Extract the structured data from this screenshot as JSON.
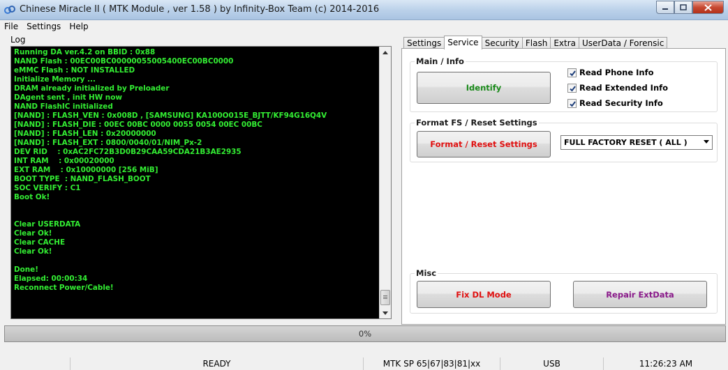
{
  "window": {
    "title": "Chinese Miracle II ( MTK Module , ver 1.58 ) by Infinity-Box Team (c) 2014-2016",
    "icon": "cm-logo-icon"
  },
  "menu": [
    "File",
    "Settings",
    "Help"
  ],
  "log": {
    "label": "Log",
    "text_color": "#33ee33",
    "lines": [
      "Running DA ver.4.2 on BBID : 0x88",
      "NAND Flash : 00EC00BC00000055005400EC00BC0000",
      "eMMC Flash : NOT INSTALLED",
      "Initialize Memory ...",
      "DRAM already initialized by Preloader",
      "DAgent sent , init HW now",
      "NAND FlashIC initialized",
      "[NAND] : FLASH_VEN : 0x008D , [SAMSUNG] KA100O015E_BJTT/KF94G16Q4V",
      "[NAND] : FLASH_DIE : 00EC 00BC 0000 0055 0054 00EC 00BC",
      "[NAND] : FLASH_LEN : 0x20000000",
      "[NAND] : FLASH_EXT : 0800/0040/01/NIM_Px-2",
      "DEV RID    : 0xAC2FC72B3D0B29CAA59CDA21B3AE2935",
      "INT RAM    : 0x00020000",
      "EXT RAM    : 0x10000000 [256 MiB]",
      "BOOT TYPE  : NAND_FLASH_BOOT",
      "SOC VERIFY : C1",
      "Boot Ok!",
      "",
      "",
      "Clear USERDATA",
      "Clear Ok!",
      "Clear CACHE",
      "Clear Ok!",
      "",
      "Done!",
      "Elapsed: 00:00:34",
      "Reconnect Power/Cable!"
    ]
  },
  "tabs": [
    "Settings",
    "Service",
    "Security",
    "Flash",
    "Extra",
    "UserData / Forensic"
  ],
  "active_tab": "Service",
  "main_info": {
    "title": "Main / Info",
    "identify_label": "Identify",
    "identify_color": "#1a8a1a",
    "checks": [
      {
        "label": "Read Phone Info",
        "checked": true
      },
      {
        "label": "Read Extended Info",
        "checked": true
      },
      {
        "label": "Read Security Info",
        "checked": true
      }
    ]
  },
  "format": {
    "title": "Format FS / Reset Settings",
    "button_label": "Format / Reset Settings",
    "button_color": "#e01010",
    "select_value": "FULL FACTORY RESET ( ALL )"
  },
  "misc": {
    "title": "Misc",
    "fix_dl_label": "Fix DL Mode",
    "fix_dl_color": "#e01010",
    "repair_label": "Repair ExtData",
    "repair_color": "#8a1a8a"
  },
  "progress": {
    "value": 0,
    "text": "0%"
  },
  "status": {
    "state": "READY",
    "platform": "MTK SP 65|67|83|81|xx",
    "port": "USB",
    "time": "11:26:23 AM"
  }
}
